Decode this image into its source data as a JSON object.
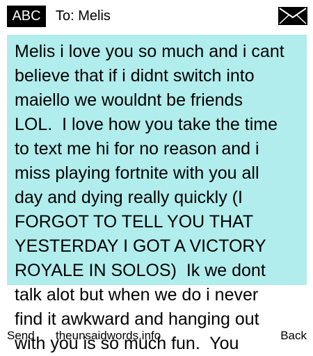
{
  "header": {
    "mode_label": "ABC",
    "recipient": "To: Melis",
    "message_icon": "envelope-icon"
  },
  "message": {
    "lines": [
      "Melis i love you so much and i cant",
      "believe that if i didnt switch into",
      "maiello we wouldnt be friends",
      "LOL.  I love how you take the time",
      "to text me hi for no reason and i",
      "miss playing fortnite with you all",
      "day and dying really quickly (I",
      "FORGOT TO TELL YOU THAT",
      "YESTERDAY I GOT A VICTORY",
      "ROYALE IN SOLOS)  Ik we dont",
      "talk alot but when we do i never",
      "find it awkward and hanging out",
      "with you is so much fun.  You"
    ],
    "highlight_color": "#b1eded"
  },
  "softkeys": {
    "left": "Send",
    "right": "Back"
  },
  "watermark": "theunsaidwords.info"
}
